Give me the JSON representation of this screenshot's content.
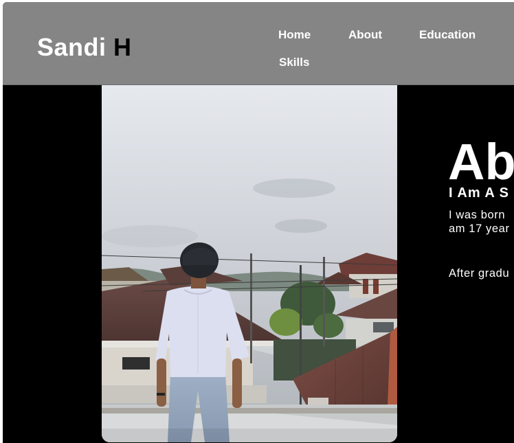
{
  "header": {
    "brand_first": "Sandi",
    "brand_accent": "H",
    "nav": [
      "Home",
      "About",
      "Education",
      "Skills"
    ]
  },
  "about": {
    "title": "Ab",
    "subtitle": "I Am A S",
    "para1_line1": "I was born",
    "para1_line2": "am 17 year",
    "para2": "After gradu"
  },
  "colors": {
    "header_bg": "#858585",
    "page_bg": "#000000",
    "brand_accent": "#000000",
    "text": "#ffffff"
  }
}
